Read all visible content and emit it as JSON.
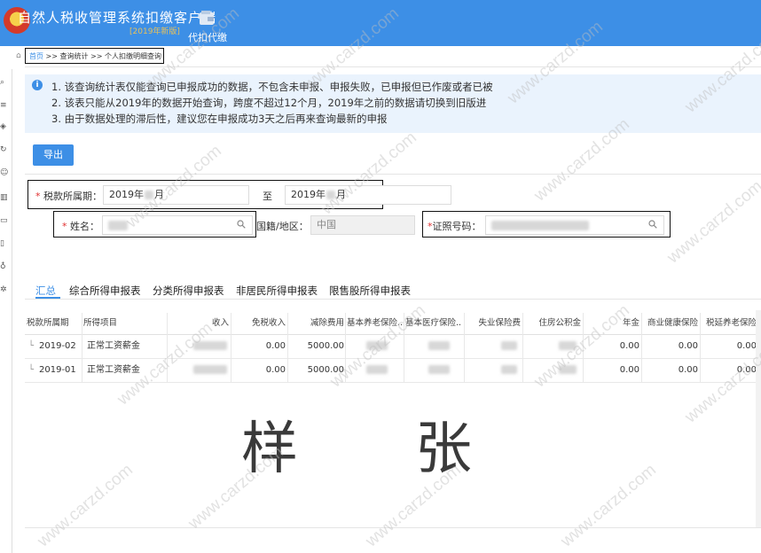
{
  "app": {
    "title": "自然人税收管理系统扣缴客户端",
    "version": "[2019年新版]",
    "module_label": "代扣代缴"
  },
  "breadcrumb": {
    "home": "首页",
    "sep1": ">>",
    "item1": "查询统计",
    "sep2": ">>",
    "item2": "个人扣缴明细查询"
  },
  "notice": {
    "line1": "1. 该查询统计表仅能查询已申报成功的数据，不包含未申报、申报失败，已申报但已作废或者已被",
    "line2": "2. 该表只能从2019年的数据开始查询，跨度不超过12个月，2019年之前的数据请切换到旧版进",
    "line3": "3. 由于数据处理的滞后性，建议您在申报成功3天之后再来查询最新的申报"
  },
  "toolbar": {
    "export_label": "导出"
  },
  "form": {
    "period_label": "税款所属期：",
    "period_from": "2019年",
    "period_from_suffix": "月",
    "to_label": "至",
    "period_to": "2019年",
    "period_to_suffix": "月",
    "name_label": "姓名：",
    "nationality_label": "国籍/地区：",
    "nationality_value": "中国",
    "id_label": "证照号码："
  },
  "tabs": [
    {
      "label": "汇总"
    },
    {
      "label": "综合所得申报表"
    },
    {
      "label": "分类所得申报表"
    },
    {
      "label": "非居民所得申报表"
    },
    {
      "label": "限售股所得申报表"
    }
  ],
  "table": {
    "headers": [
      "税款所属期",
      "所得项目",
      "收入",
      "免税收入",
      "减除费用",
      "基本养老保险...",
      "基本医疗保险...",
      "失业保险费",
      "住房公积金",
      "年金",
      "商业健康保险",
      "税延养老保险"
    ],
    "rows": [
      {
        "period": "2019-02",
        "item": "正常工资薪金",
        "tax_free": "0.00",
        "deduction": "5000.00",
        "annuity": "0.00",
        "health_ins": "0.00",
        "pension_ins": "0.00"
      },
      {
        "period": "2019-01",
        "item": "正常工资薪金",
        "tax_free": "0.00",
        "deduction": "5000.00",
        "annuity": "0.00",
        "health_ins": "0.00",
        "pension_ins": "0.00"
      }
    ]
  },
  "stamp": {
    "char1": "样",
    "char2": "张"
  },
  "watermark": {
    "text": "www.carzd.com"
  }
}
